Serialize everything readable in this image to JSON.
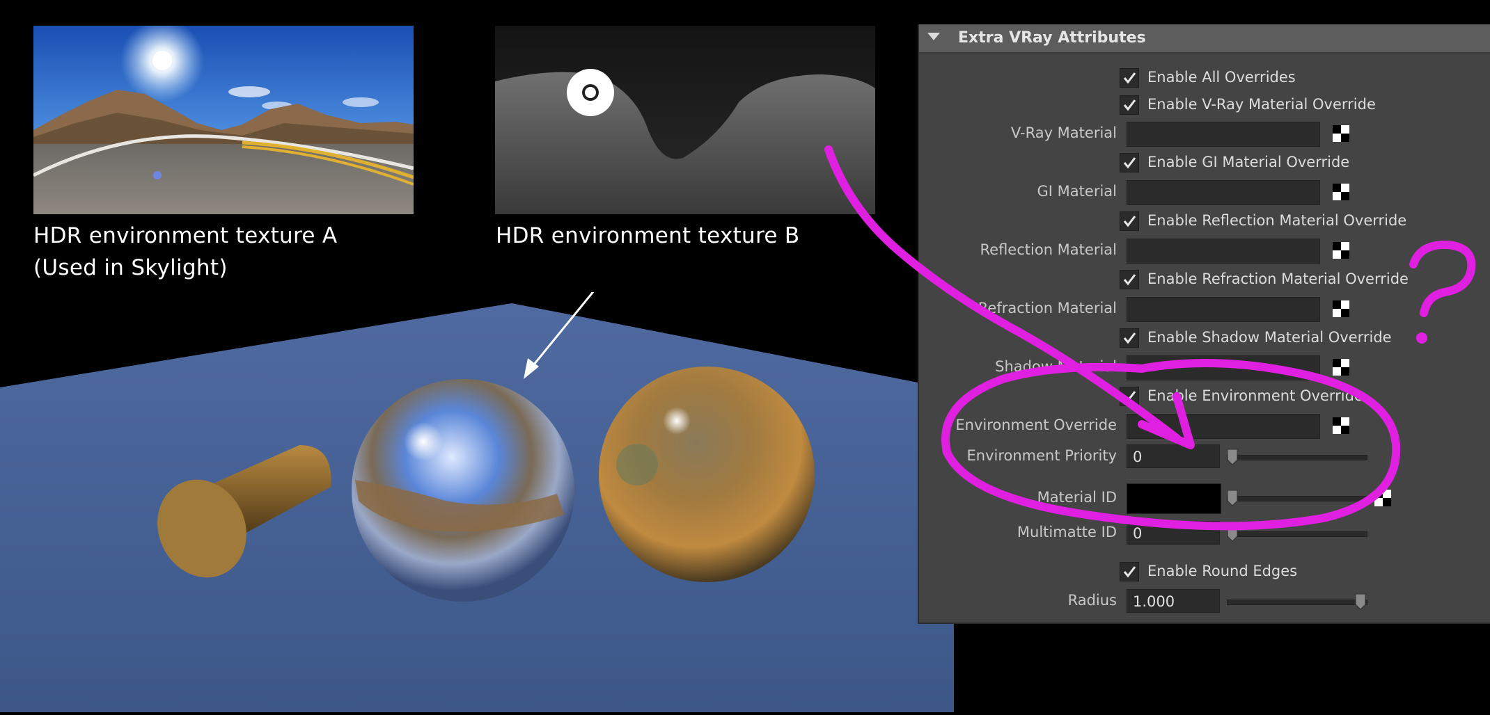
{
  "textures": {
    "a": {
      "caption_line1": "HDR environment  texture A",
      "caption_line2": "(Used in Skylight)"
    },
    "b": {
      "caption_line1": "HDR environment  texture B"
    }
  },
  "panel": {
    "title": "Extra VRay Attributes",
    "checkboxes": {
      "enable_all_overrides": "Enable All Overrides",
      "enable_vray_material_override": "Enable V-Ray Material Override",
      "enable_gi_material_override": "Enable GI Material Override",
      "enable_reflection_material_override": "Enable Reflection Material Override",
      "enable_refraction_material_override": "Enable Refraction Material Override",
      "enable_shadow_material_override": "Enable Shadow Material Override",
      "enable_environment_override": "Enable Environment Override",
      "enable_round_edges": "Enable Round Edges"
    },
    "labels": {
      "vray_material": "V-Ray Material",
      "gi_material": "GI Material",
      "reflection_material": "Reflection Material",
      "refraction_material": "Refraction Material",
      "shadow_material": "Shadow Material",
      "environment_override": "Environment Override",
      "environment_priority": "Environment Priority",
      "material_id": "Material ID",
      "multimatte_id": "Multimatte ID",
      "radius": "Radius"
    },
    "values": {
      "environment_priority": "0",
      "multimatte_id": "0",
      "radius": "1.000"
    },
    "colors": {
      "panel_bg": "#444444",
      "field_bg": "#2b2b2b",
      "material_id_color": "#000000"
    }
  },
  "annotation": {
    "question_mark": "?",
    "color": "#e020e0"
  }
}
